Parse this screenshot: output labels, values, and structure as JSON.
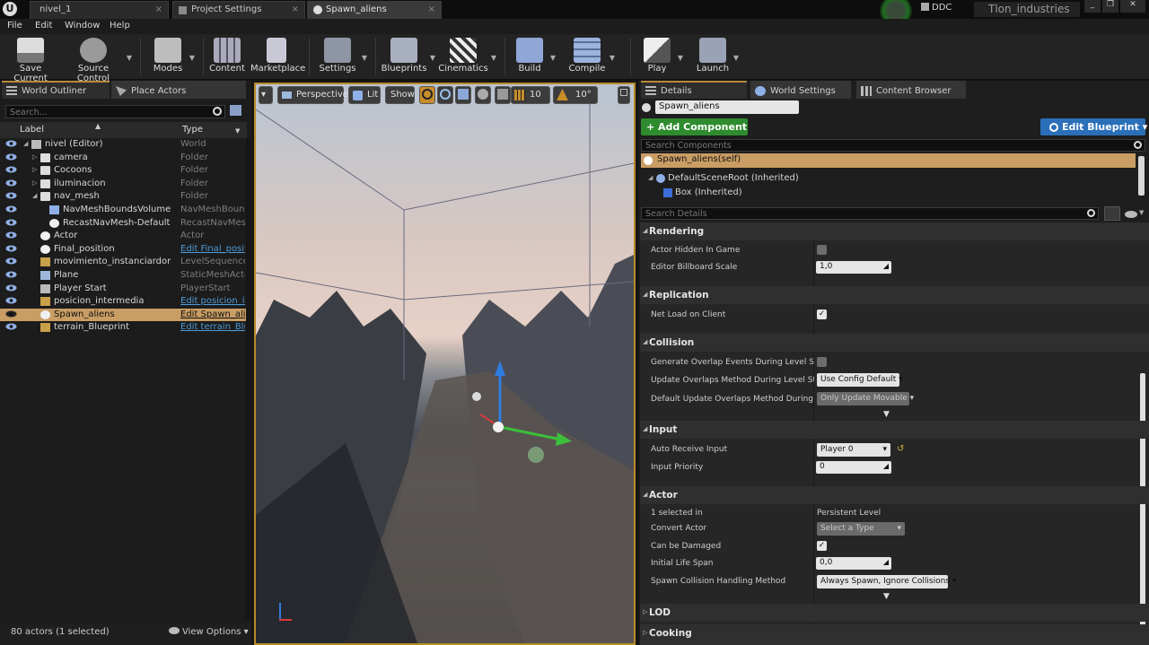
{
  "window": {
    "tabs": [
      "nivel_1",
      "Project Settings",
      "Spawn_aliens"
    ],
    "ddc_label": "DDC",
    "company": "Tlon_industries",
    "controls": [
      "_",
      "❐",
      "✕"
    ]
  },
  "menubar": {
    "items": [
      "File",
      "Edit",
      "Window",
      "Help"
    ]
  },
  "toolbar": {
    "buttons": [
      {
        "label": "Save Current"
      },
      {
        "label": "Source Control"
      },
      {
        "label": "Modes"
      },
      {
        "label": "Content"
      },
      {
        "label": "Marketplace"
      },
      {
        "label": "Settings"
      },
      {
        "label": "Blueprints"
      },
      {
        "label": "Cinematics"
      },
      {
        "label": "Build"
      },
      {
        "label": "Compile"
      },
      {
        "label": "Play"
      },
      {
        "label": "Launch"
      }
    ]
  },
  "outliner": {
    "tabs": [
      "World Outliner",
      "Place Actors"
    ],
    "search_placeholder": "Search...",
    "col_label": "Label",
    "col_type": "Type",
    "rows": [
      {
        "label": "nivel (Editor)",
        "type": "World",
        "link": false
      },
      {
        "label": "camera",
        "type": "Folder",
        "link": false
      },
      {
        "label": "Cocoons",
        "type": "Folder",
        "link": false
      },
      {
        "label": "iluminacion",
        "type": "Folder",
        "link": false
      },
      {
        "label": "nav_mesh",
        "type": "Folder",
        "link": false
      },
      {
        "label": "NavMeshBoundsVolume",
        "type": "NavMeshBounds",
        "link": false
      },
      {
        "label": "RecastNavMesh-Default",
        "type": "RecastNavMesh",
        "link": false
      },
      {
        "label": "Actor",
        "type": "Actor",
        "link": false
      },
      {
        "label": "Final_position",
        "type": "Edit Final_positi",
        "link": true
      },
      {
        "label": "movimiento_instanciardor",
        "type": "LevelSequenceAc",
        "link": false
      },
      {
        "label": "Plane",
        "type": "StaticMeshActor",
        "link": false
      },
      {
        "label": "Player Start",
        "type": "PlayerStart",
        "link": false
      },
      {
        "label": "posicion_intermedia",
        "type": "Edit posicion_in",
        "link": true
      },
      {
        "label": "Spawn_aliens",
        "type": "Edit Spawn_alie",
        "link": true
      },
      {
        "label": "terrain_Blueprint",
        "type": "Edit terrain_Blu",
        "link": true
      }
    ],
    "status": "80 actors (1 selected)",
    "view_options": "View Options"
  },
  "viewport": {
    "perspective": "Perspective",
    "lit": "Lit",
    "show": "Show",
    "grid_snap": "10",
    "rot_snap": "10°"
  },
  "details": {
    "tabs": [
      "Details",
      "World Settings",
      "Content Browser"
    ],
    "actor_name": "Spawn_aliens",
    "add_component": "+ Add Component",
    "edit_blueprint": "Edit Blueprint",
    "search_components": "Search Components",
    "self_component": "Spawn_aliens(self)",
    "default_root": "DefaultSceneRoot (Inherited)",
    "box": "Box (Inherited)",
    "search_details": "Search Details",
    "cat_rendering": "Rendering",
    "actor_hidden": "Actor Hidden In Game",
    "billboard_scale": "Editor Billboard Scale",
    "billboard_value": "1,0",
    "cat_replication": "Replication",
    "net_load": "Net Load on Client",
    "cat_collision": "Collision",
    "gen_overlap": "Generate Overlap Events During Level Stream",
    "update_overlaps": "Update Overlaps Method During Level Stream",
    "update_overlaps_value": "Use Config Default",
    "default_update": "Default Update Overlaps Method During Leve",
    "default_update_value": "Only Update Movable",
    "cat_input": "Input",
    "auto_receive": "Auto Receive Input",
    "auto_receive_value": "Player 0",
    "input_priority": "Input Priority",
    "input_priority_value": "0",
    "cat_actor": "Actor",
    "selected_in": "1 selected in",
    "selected_in_value": "Persistent Level",
    "convert_actor": "Convert Actor",
    "convert_actor_value": "Select a Type",
    "can_be_damaged": "Can be Damaged",
    "life_span": "Initial Life Span",
    "life_span_value": "0,0",
    "spawn_collision": "Spawn Collision Handling Method",
    "spawn_collision_value": "Always Spawn, Ignore Collisions",
    "cat_lod": "LOD",
    "cat_cooking": "Cooking"
  },
  "colors": {
    "accent": "#c99d63",
    "link": "#4e9bd6",
    "add_component": "#2e8b2e",
    "edit_blueprint": "#2b6fb8"
  }
}
